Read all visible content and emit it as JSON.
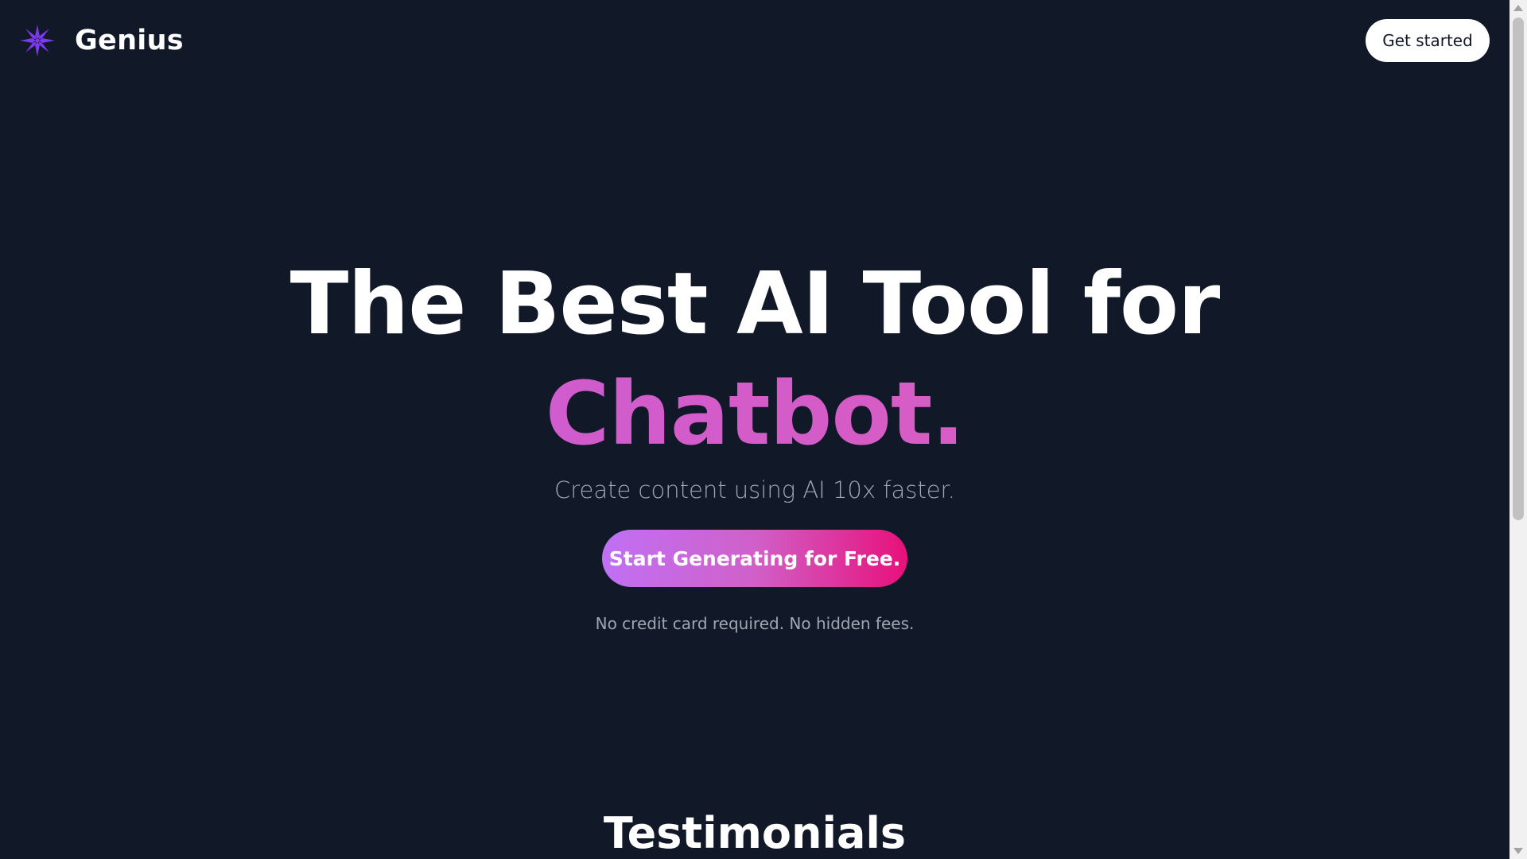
{
  "nav": {
    "brand": "Genius",
    "brand_icon": "sparkle-star-icon",
    "brand_color": "#7c3aed",
    "get_started_label": "Get started"
  },
  "hero": {
    "headline": "The Best AI Tool for",
    "headline_accent": "Chatbot.",
    "accent_color": "#d65cc6",
    "subtitle": "Create content using AI 10x faster.",
    "cta_label": "Start Generating for Free.",
    "cta_gradient": [
      "#c070f5",
      "#e8107a"
    ],
    "note": "No credit card required. No hidden fees."
  },
  "sections": {
    "testimonials_title": "Testimonials"
  },
  "colors": {
    "background": "#111827",
    "text": "#ffffff",
    "muted": "#a1a6b3"
  }
}
